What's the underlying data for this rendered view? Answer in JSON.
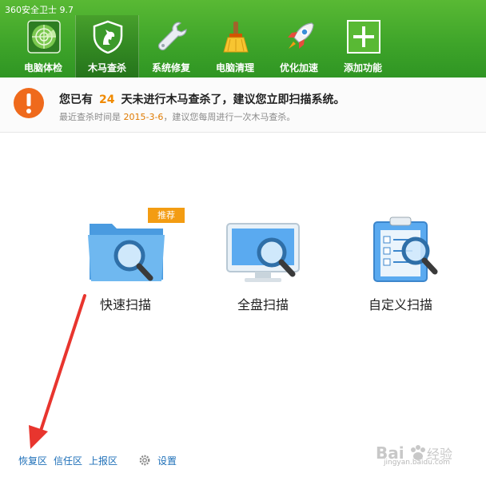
{
  "window": {
    "title": "360安全卫士 9.7"
  },
  "nav": {
    "items": [
      {
        "label": "电脑体检",
        "icon": "radar-icon"
      },
      {
        "label": "木马查杀",
        "icon": "horse-shield-icon",
        "active": true
      },
      {
        "label": "系统修复",
        "icon": "wrench-icon"
      },
      {
        "label": "电脑清理",
        "icon": "broom-icon"
      },
      {
        "label": "优化加速",
        "icon": "rocket-icon"
      },
      {
        "label": "添加功能",
        "icon": "plus-icon"
      }
    ]
  },
  "warning": {
    "prefix": "您已有",
    "days": "24",
    "suffix": "天未进行木马查杀了，建议您立即扫描系统。",
    "last_prefix": "最近查杀时间是",
    "last_date": "2015-3-6",
    "last_suffix": "，建议您每周进行一次木马查杀。"
  },
  "scan": {
    "quick": {
      "label": "快速扫描",
      "badge": "推荐"
    },
    "full": {
      "label": "全盘扫描"
    },
    "custom": {
      "label": "自定义扫描"
    }
  },
  "footer": {
    "restore": "恢复区",
    "trust": "信任区",
    "report": "上报区",
    "settings": "设置"
  },
  "watermark": {
    "brand": "Baidu 经验",
    "url": "jingyan.baidu.com"
  },
  "colors": {
    "header_green": "#3fa52a",
    "accent_orange": "#f08a00",
    "link_blue": "#1d6fb8",
    "arrow_red": "#e8352e"
  }
}
